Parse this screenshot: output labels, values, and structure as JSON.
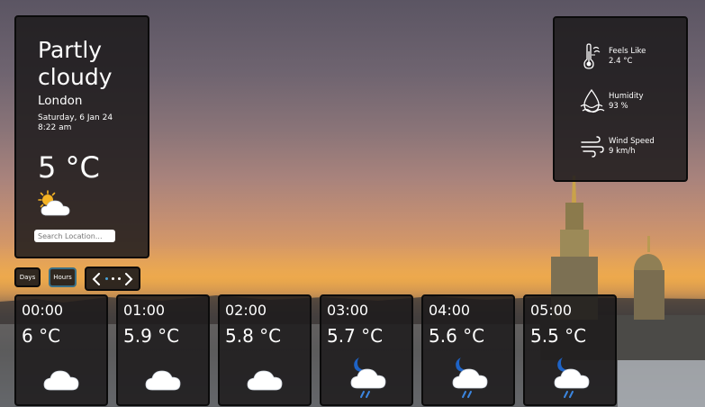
{
  "current": {
    "condition": "Partly cloudy",
    "city": "London",
    "date": "Saturday, 6 Jan 24",
    "time": "8:22 am",
    "temperature": "5 °C",
    "icon": "partly-cloudy-day-icon"
  },
  "search": {
    "placeholder": "Search Location..."
  },
  "stats": {
    "feels_like": {
      "label": "Feels Like",
      "value": "2.4 °C",
      "icon": "thermometer-icon"
    },
    "humidity": {
      "label": "Humidity",
      "value": "93 %",
      "icon": "humidity-drop-icon"
    },
    "wind_speed": {
      "label": "Wind Speed",
      "value": "9 km/h",
      "icon": "wind-icon"
    }
  },
  "controls": {
    "days_label": "Days",
    "hours_label": "Hours",
    "prev_icon": "chevron-left-icon",
    "next_icon": "chevron-right-icon",
    "active_page": 1,
    "page_count": 3
  },
  "hourly": [
    {
      "time": "00:00",
      "temp": "6 °C",
      "icon": "cloud-icon"
    },
    {
      "time": "01:00",
      "temp": "5.9 °C",
      "icon": "cloud-icon"
    },
    {
      "time": "02:00",
      "temp": "5.8 °C",
      "icon": "cloud-icon"
    },
    {
      "time": "03:00",
      "temp": "5.7 °C",
      "icon": "night-cloud-drizzle-icon"
    },
    {
      "time": "04:00",
      "temp": "5.6 °C",
      "icon": "night-cloud-drizzle-icon"
    },
    {
      "time": "05:00",
      "temp": "5.5 °C",
      "icon": "night-cloud-drizzle-icon"
    }
  ],
  "colors": {
    "card_bg": "#1c1a1b",
    "accent": "#4aa3d8",
    "sun": "#f5b323",
    "moon": "#1e63c6"
  }
}
